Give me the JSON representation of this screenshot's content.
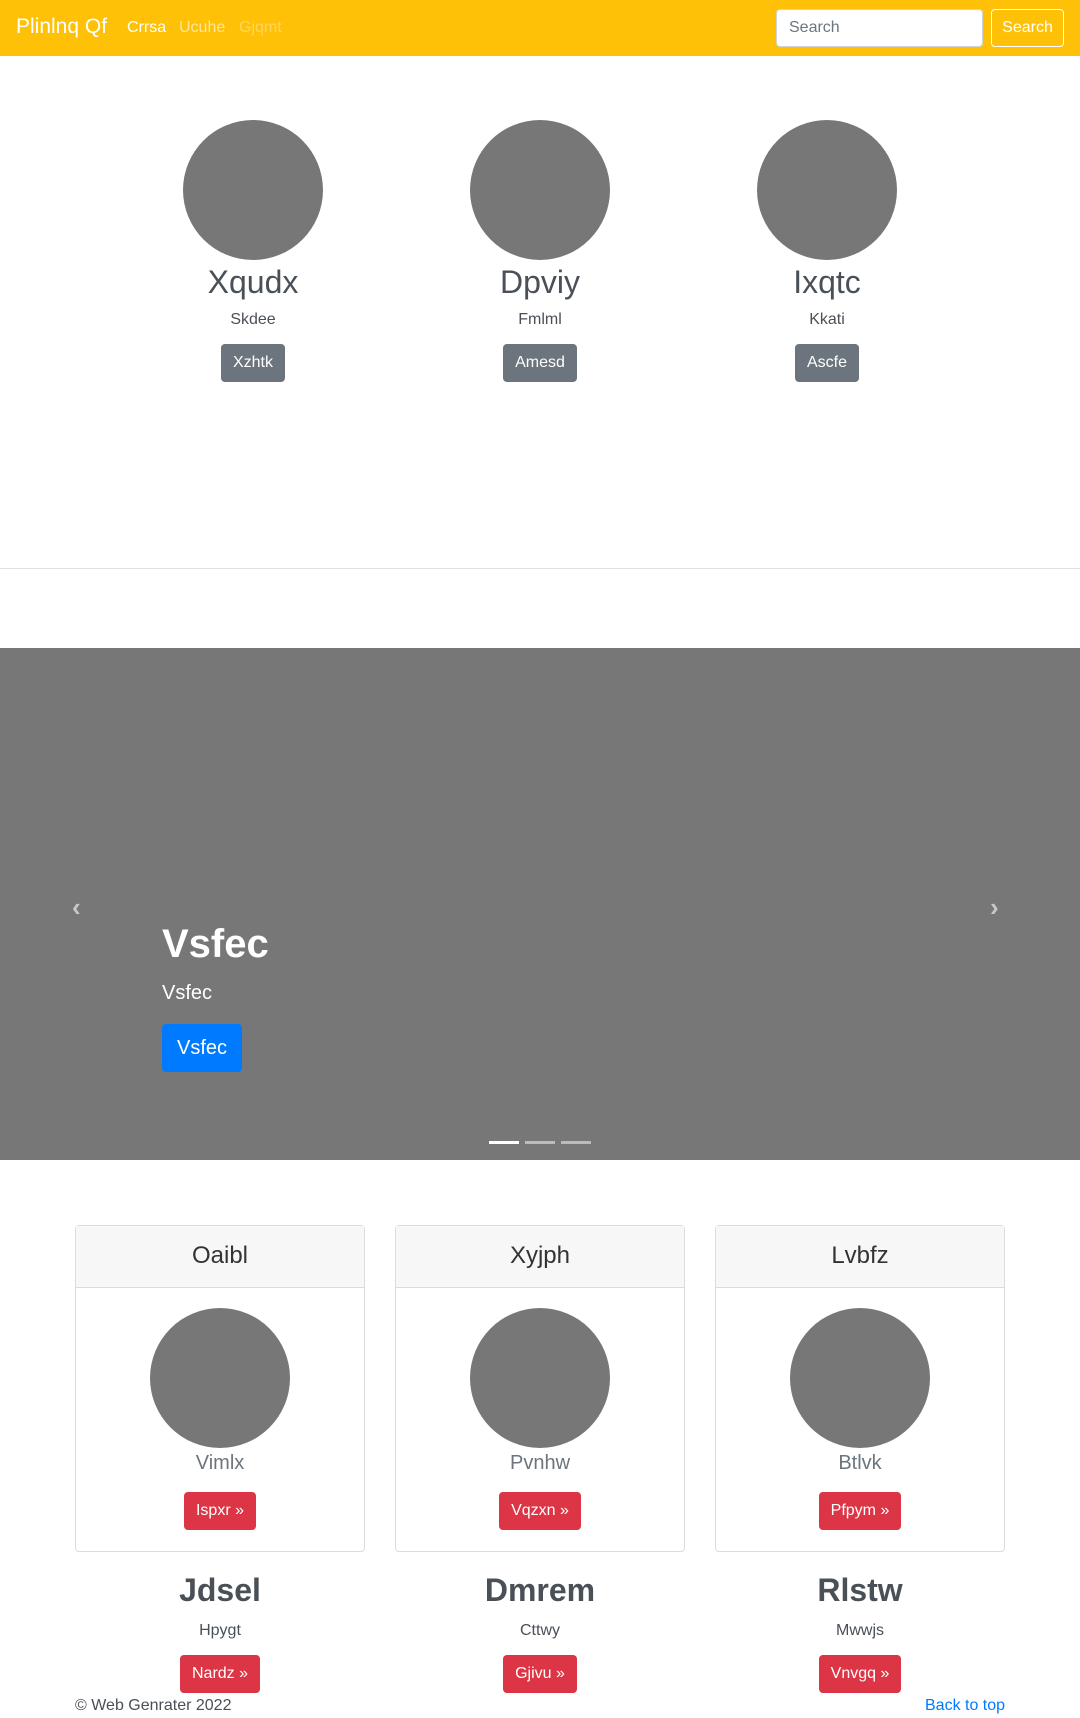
{
  "navbar": {
    "brand": "Plinlnq Qf",
    "links": [
      "Crrsa",
      "Ucuhe",
      "Gjqmt"
    ],
    "search_placeholder": "Search",
    "search_button": "Search"
  },
  "profiles": [
    {
      "name": "Xqudx",
      "sub": "Skdee",
      "button": "Xzhtk"
    },
    {
      "name": "Dpviy",
      "sub": "Fmlml",
      "button": "Amesd"
    },
    {
      "name": "Ixqtc",
      "sub": "Kkati",
      "button": "Ascfe"
    }
  ],
  "carousel": {
    "prev_icon": "‹",
    "next_icon": "›",
    "title": "Vsfec",
    "subtitle": "Vsfec",
    "button": "Vsfec",
    "slide_count": 3,
    "active_slide": 1
  },
  "cards": [
    {
      "header": "Oaibl",
      "label": "Vimlx",
      "button": "Ispxr »"
    },
    {
      "header": "Xyjph",
      "label": "Pvnhw",
      "button": "Vqzxn »"
    },
    {
      "header": "Lvbfz",
      "label": "Btlvk",
      "button": "Pfpym »"
    }
  ],
  "columns": [
    {
      "title": "Jdsel",
      "sub": "Hpygt",
      "button": "Nardz »"
    },
    {
      "title": "Dmrem",
      "sub": "Cttwy",
      "button": "Gjivu »"
    },
    {
      "title": "Rlstw",
      "sub": "Mwwjs",
      "button": "Vnvgq »"
    }
  ],
  "footer": {
    "copyright": "© Web Genrater 2022",
    "back_to_top": "Back to top"
  }
}
